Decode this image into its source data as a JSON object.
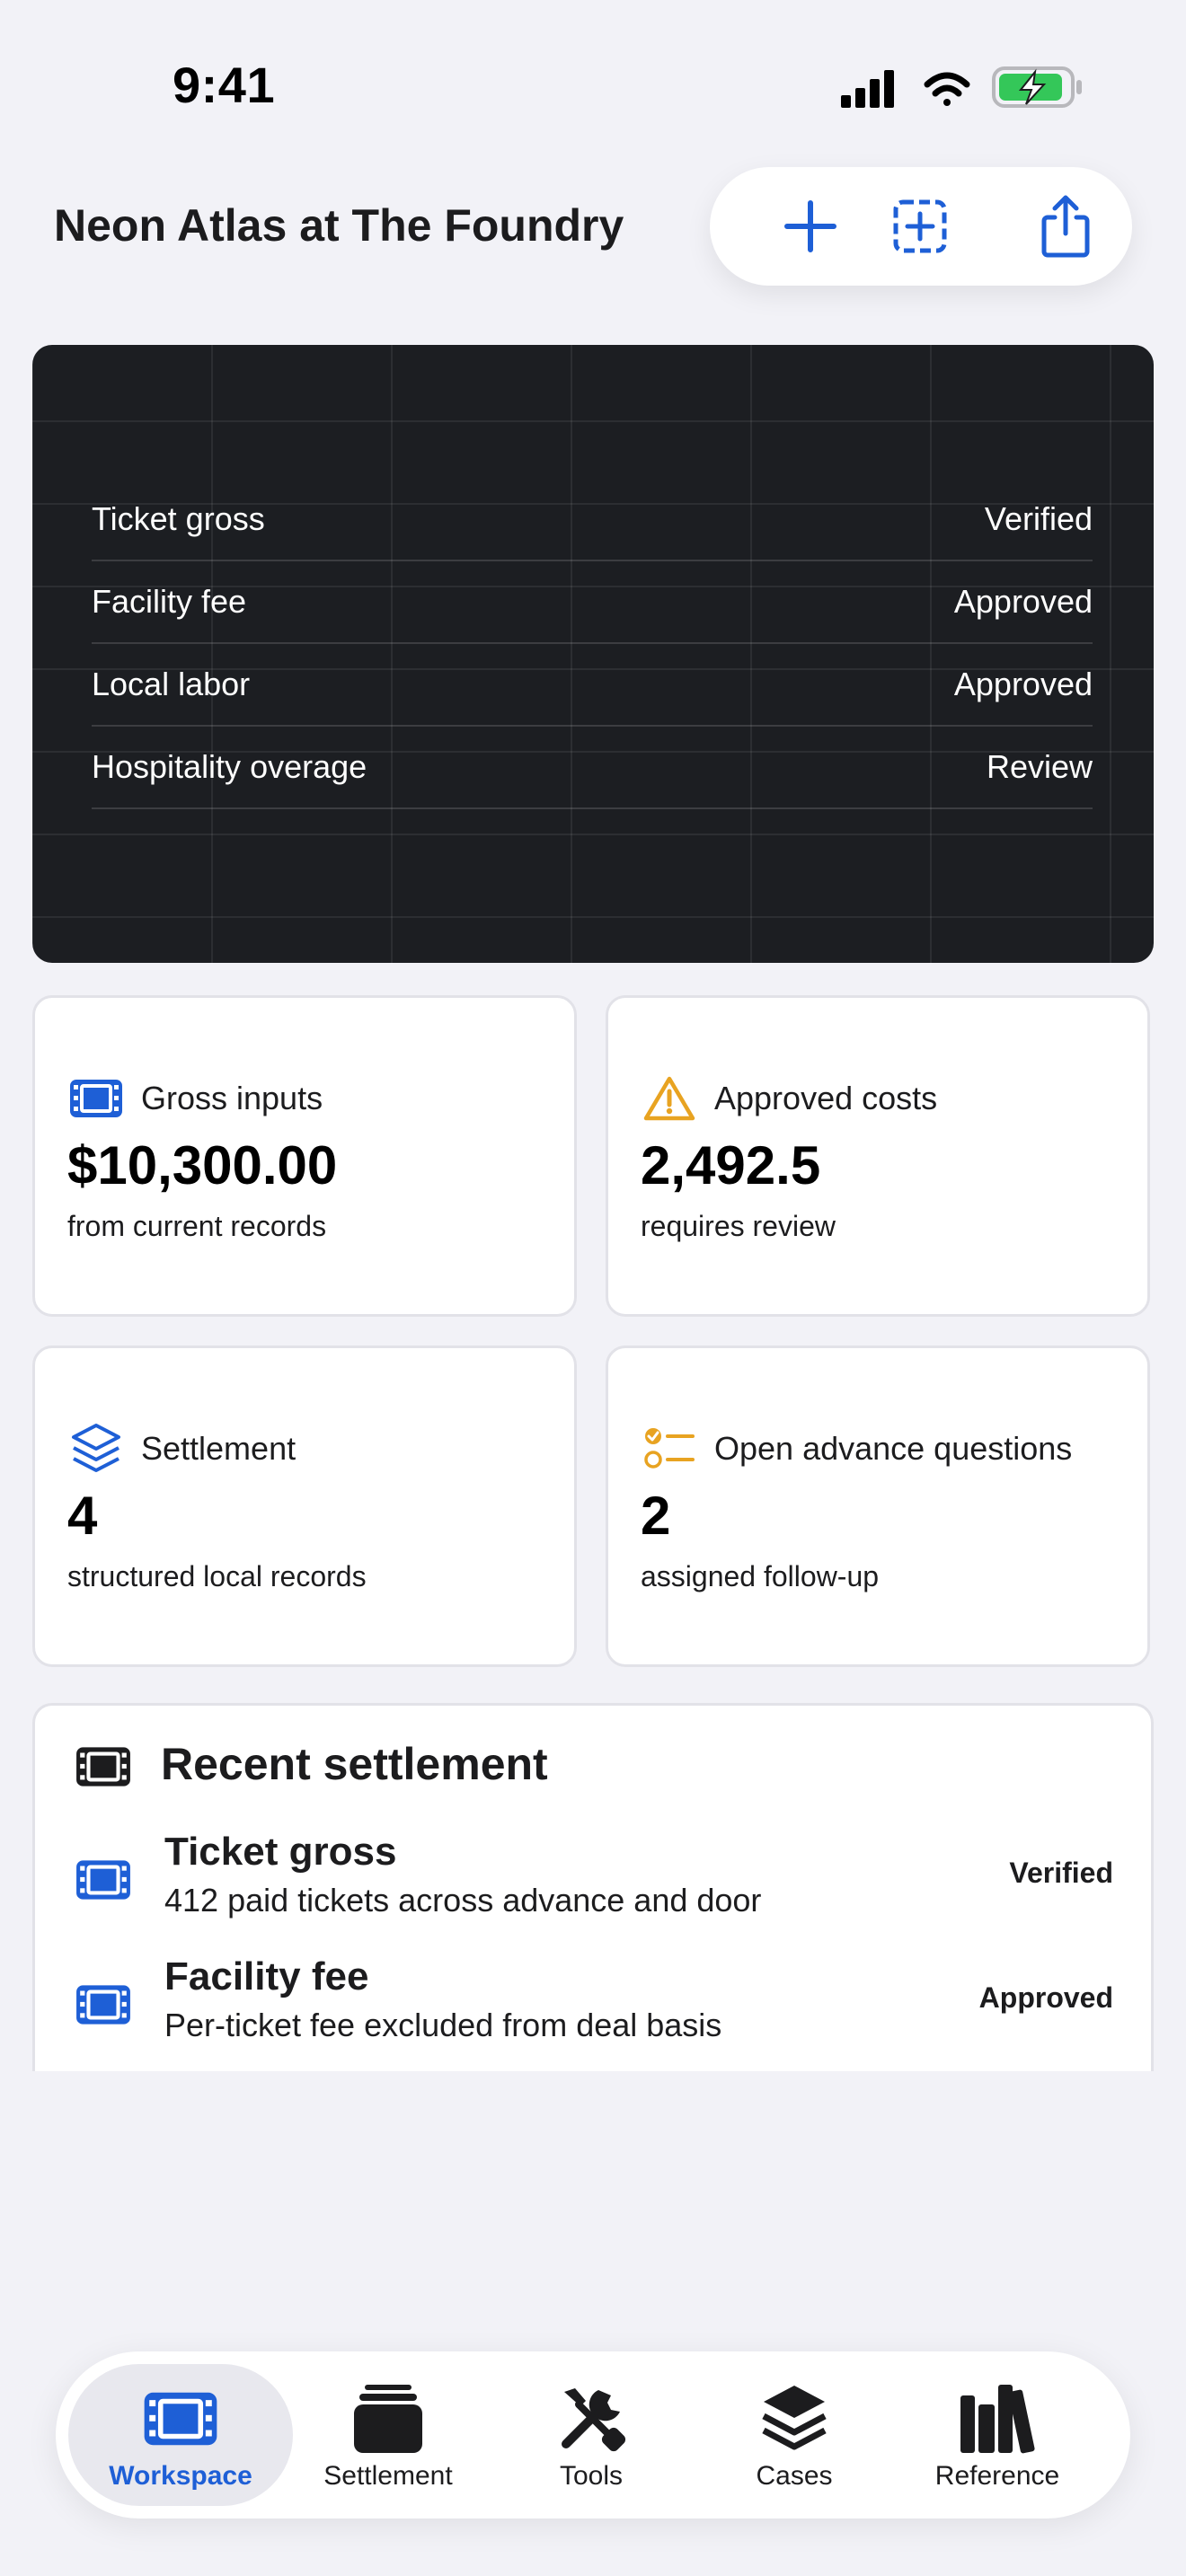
{
  "status_bar": {
    "time": "9:41"
  },
  "header": {
    "title": "Neon Atlas at The Foundry"
  },
  "toolbar": {
    "icons": [
      "plus-icon",
      "add-square-icon",
      "share-icon"
    ]
  },
  "breakdown": {
    "rows": [
      {
        "label": "Ticket gross",
        "status": "Verified"
      },
      {
        "label": "Facility fee",
        "status": "Approved"
      },
      {
        "label": "Local labor",
        "status": "Approved"
      },
      {
        "label": "Hospitality overage",
        "status": "Review"
      }
    ]
  },
  "stats": [
    {
      "icon": "film-icon",
      "label": "Gross inputs",
      "value": "$10,300.00",
      "sub": "from current records"
    },
    {
      "icon": "warning-icon",
      "label": "Approved costs",
      "value": "2,492.5",
      "sub": "requires review"
    },
    {
      "icon": "layers-icon",
      "label": "Settlement",
      "value": "4",
      "sub": "structured local records"
    },
    {
      "icon": "checklist-icon",
      "label": "Open advance questions",
      "value": "2",
      "sub": "assigned follow-up"
    }
  ],
  "recent": {
    "title": "Recent settlement",
    "items": [
      {
        "title": "Ticket gross",
        "subtitle": "412 paid tickets across advance and door",
        "status": "Verified"
      },
      {
        "title": "Facility fee",
        "subtitle": "Per-ticket fee excluded from deal basis",
        "status": "Approved"
      }
    ]
  },
  "tabs": [
    {
      "label": "Workspace",
      "icon": "film-icon",
      "active": true
    },
    {
      "label": "Settlement",
      "icon": "stack-icon",
      "active": false
    },
    {
      "label": "Tools",
      "icon": "tools-icon",
      "active": false
    },
    {
      "label": "Cases",
      "icon": "layers-icon",
      "active": false
    },
    {
      "label": "Reference",
      "icon": "books-icon",
      "active": false
    }
  ],
  "colors": {
    "accent": "#1e5fd6",
    "warning": "#e8a321",
    "dark_card": "#1c1e22",
    "background": "#f2f2f7",
    "battery": "#34c759"
  }
}
